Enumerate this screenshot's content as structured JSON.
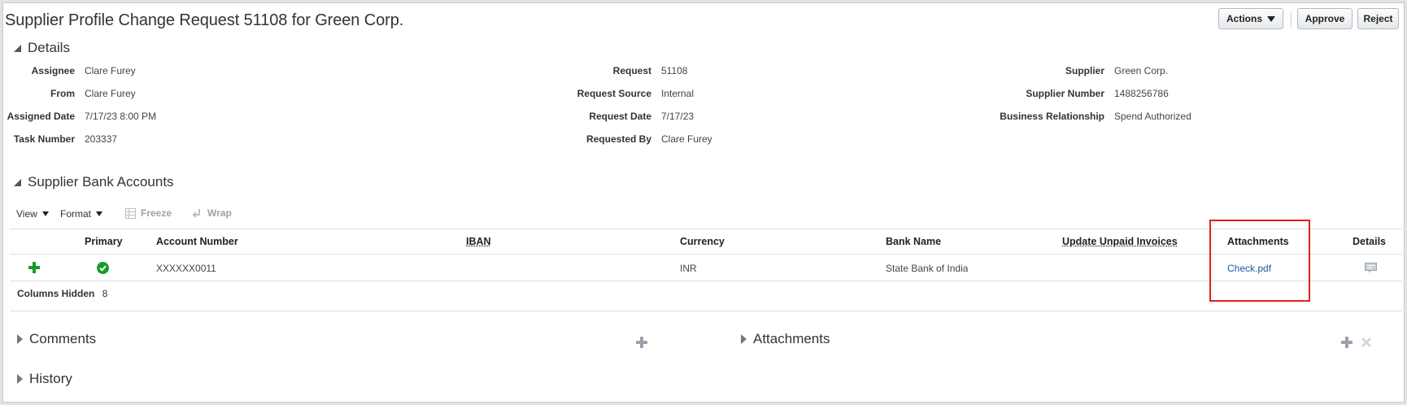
{
  "header": {
    "title": "Supplier Profile Change Request 51108 for Green Corp.",
    "actions_label": "Actions",
    "approve_label": "Approve",
    "reject_label": "Reject"
  },
  "details": {
    "heading": "Details",
    "col1": [
      {
        "label": "Assignee",
        "value": "Clare Furey"
      },
      {
        "label": "From",
        "value": "Clare Furey"
      },
      {
        "label": "Assigned Date",
        "value": "7/17/23 8:00 PM"
      },
      {
        "label": "Task Number",
        "value": "203337"
      }
    ],
    "col2": [
      {
        "label": "Request",
        "value": "51108"
      },
      {
        "label": "Request Source",
        "value": "Internal"
      },
      {
        "label": "Request Date",
        "value": "7/17/23"
      },
      {
        "label": "Requested By",
        "value": "Clare Furey"
      }
    ],
    "col3": [
      {
        "label": "Supplier",
        "value": "Green Corp."
      },
      {
        "label": "Supplier Number",
        "value": "1488256786"
      },
      {
        "label": "Business Relationship",
        "value": "Spend Authorized"
      }
    ]
  },
  "bank": {
    "heading": "Supplier Bank Accounts",
    "toolbar": {
      "view": "View",
      "format": "Format",
      "freeze": "Freeze",
      "wrap": "Wrap"
    },
    "columns": {
      "primary": "Primary",
      "account_number": "Account Number",
      "iban": "IBAN",
      "currency": "Currency",
      "bank_name": "Bank Name",
      "update_unpaid": "Update Unpaid Invoices",
      "attachments": "Attachments",
      "details": "Details"
    },
    "rows": [
      {
        "account_number": "XXXXXX0011",
        "iban": "",
        "currency": "INR",
        "bank_name": "State Bank of India",
        "update_unpaid": "",
        "attachment": "Check.pdf"
      }
    ],
    "columns_hidden_label": "Columns Hidden",
    "columns_hidden_count": "8"
  },
  "comments": {
    "heading": "Comments"
  },
  "attachments_section": {
    "heading": "Attachments"
  },
  "history": {
    "heading": "History"
  },
  "colors": {
    "accent_link": "#145c9e",
    "add_green": "#1a9b2a",
    "highlight": "#e02020"
  }
}
